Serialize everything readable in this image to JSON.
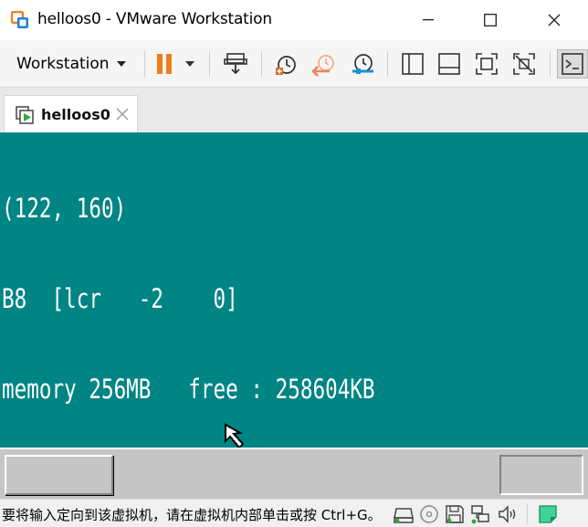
{
  "window": {
    "title": "helloos0 - VMware Workstation"
  },
  "toolbar": {
    "menu_label": "Workstation",
    "icons": [
      "pause-icon",
      "send-ctrl-alt-del-icon",
      "snapshot-icon",
      "revert-snapshot-icon",
      "snapshot-manager-icon",
      "library-view-icon",
      "thumbnail-view-icon",
      "full-screen-icon",
      "unity-icon",
      "console-view-icon"
    ]
  },
  "tabs": [
    {
      "label": "helloos0"
    }
  ],
  "vm_console": {
    "lines": [
      "(122, 160)",
      "B8  [lcr   -2    0]",
      "memory 256MB   free : 258604KB"
    ],
    "background_color": "#008484",
    "taskbar_color": "#c6c6c6"
  },
  "statusbar": {
    "message": "要将输入定向到该虚拟机，请在虚拟机内部单击或按 Ctrl+G。",
    "icons": [
      "hard-disk-icon",
      "cd-dvd-icon",
      "floppy-icon",
      "network-icon",
      "sound-icon",
      "message-icon"
    ]
  },
  "colors": {
    "accent_orange": "#f07d1c",
    "vm_teal": "#008484"
  }
}
